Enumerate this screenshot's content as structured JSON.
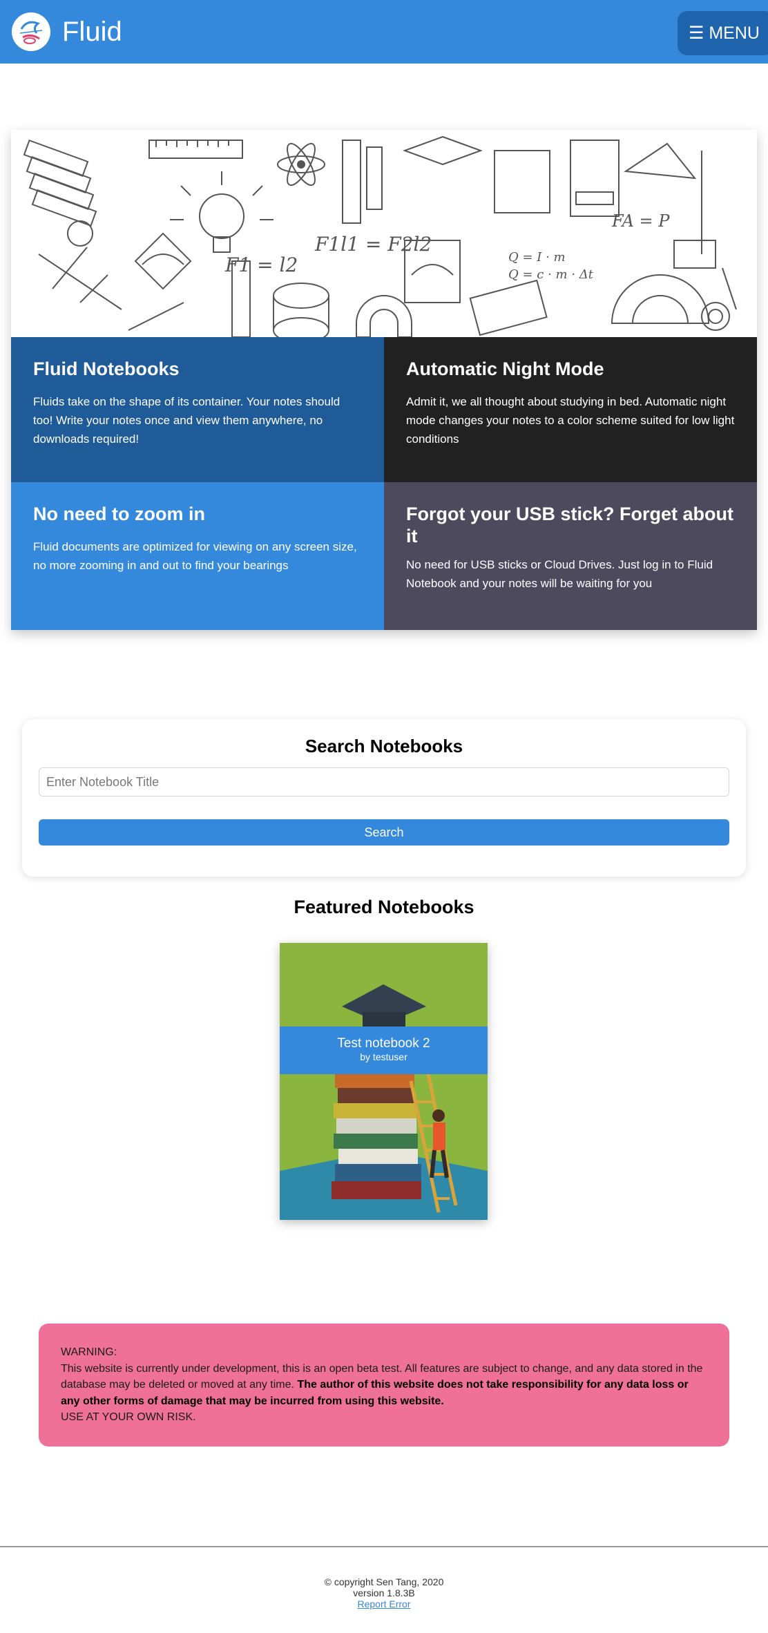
{
  "header": {
    "brand": "Fluid",
    "menu_label": "☰ MENU",
    "logo_icon": "fluid-logo-icon"
  },
  "features": [
    {
      "title": "Fluid Notebooks",
      "text": "Fluids take on the shape of its container. Your notes should too! Write your notes once and view them anywhere, no downloads required!",
      "color": "#1f5b99"
    },
    {
      "title": "Automatic Night Mode",
      "text": "Admit it, we all thought about studying in bed. Automatic night mode changes your notes to a color scheme suited for low light conditions",
      "color": "#212121"
    },
    {
      "title": "No need to zoom in",
      "text": "Fluid documents are optimized for viewing on any screen size, no more zooming in and out to find your bearings",
      "color": "#3589dc"
    },
    {
      "title": "Forgot your USB stick? Forget about it",
      "text": "No need for USB sticks or Cloud Drives. Just log in to Fluid Notebook and your notes will be waiting for you",
      "color": "#4c4a5c"
    }
  ],
  "search": {
    "title": "Search Notebooks",
    "placeholder": "Enter Notebook Title",
    "button_label": "Search"
  },
  "featured": {
    "title": "Featured Notebooks",
    "notebooks": [
      {
        "name": "Test notebook 2",
        "author": "by testuser"
      }
    ]
  },
  "warning": {
    "heading": "WARNING:",
    "text": "This website is currently under development, this is an open beta test. All features are subject to change, and any data stored in the database may be deleted or moved at any time.",
    "bold_text": "The author of this website does not take responsibility for any data loss or any other forms of damage that may be incurred from using this website.",
    "risk": "USE AT YOUR OWN RISK."
  },
  "footer": {
    "copyright": "© copyright Sen Tang, 2020",
    "version": "version 1.8.3B",
    "report_link": "Report Error"
  },
  "colors": {
    "primary": "#3589dc",
    "menu": "#1e65ad",
    "warning": "#ef7099"
  }
}
